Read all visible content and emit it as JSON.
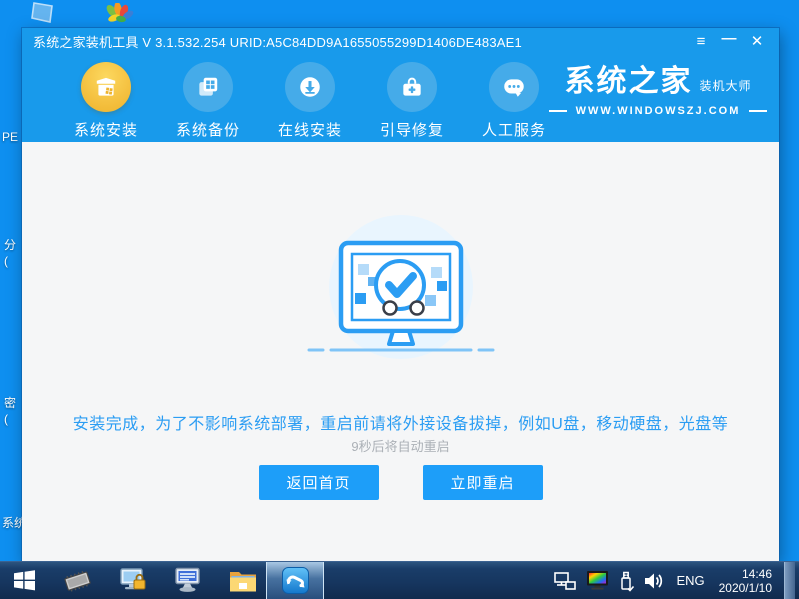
{
  "desktop": {
    "fragments": [
      "PE",
      "分",
      "(",
      "密",
      "(",
      "系统"
    ]
  },
  "window": {
    "title": "系统之家装机工具 V 3.1.532.254 URID:A5C84DD9A1655055299D1406DE483AE1",
    "controls": {
      "menu": "≡",
      "minimize": "—",
      "close": "✕"
    }
  },
  "nav": {
    "items": [
      {
        "label": "系统安装",
        "icon": "install-box-icon",
        "active": true
      },
      {
        "label": "系统备份",
        "icon": "backup-copy-icon",
        "active": false
      },
      {
        "label": "在线安装",
        "icon": "online-download-icon",
        "active": false
      },
      {
        "label": "引导修复",
        "icon": "boot-repair-toolbox-icon",
        "active": false
      },
      {
        "label": "人工服务",
        "icon": "support-chat-icon",
        "active": false
      }
    ]
  },
  "brand": {
    "name": "系统之家",
    "tagline": "装机大师",
    "website": "WWW.WINDOWSZJ.COM"
  },
  "main": {
    "message": "安装完成，为了不影响系统部署，重启前请将外接设备拔掉，例如U盘，移动硬盘，光盘等",
    "countdown": "9秒后将自动重启",
    "buttons": [
      {
        "label": "返回首页"
      },
      {
        "label": "立即重启"
      }
    ]
  },
  "taskbar": {
    "tray": {
      "language": "ENG",
      "time": "14:46",
      "date": "2020/1/10"
    }
  },
  "colors": {
    "desktop": "#0e8ff0",
    "accent_blue": "#189aeb",
    "active_circle_gold": "#f5c242",
    "inactive_circle": "#45abe9",
    "content_bg": "#f5f6f7",
    "message_blue": "#2b9df3",
    "countdown_gray": "#abb0b6",
    "button_blue": "#1d9ef9",
    "taskbar_navy": "#16365f"
  }
}
